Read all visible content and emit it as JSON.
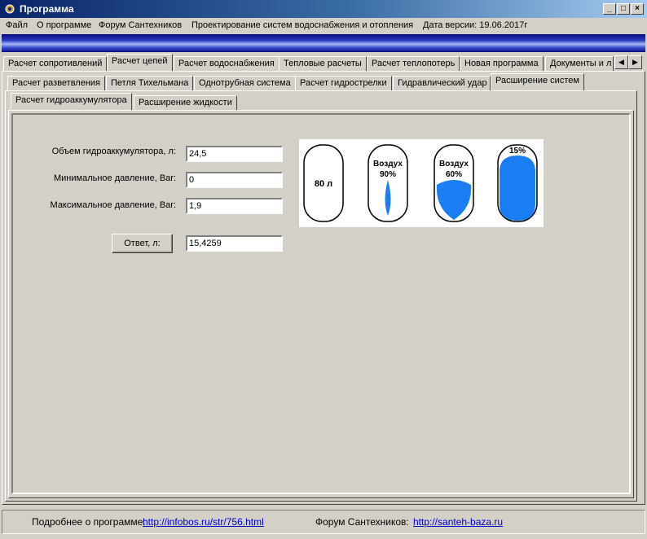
{
  "window": {
    "title": "Программа"
  },
  "menu": [
    "Файл",
    "О программе",
    "Форум Сантехников",
    "Проектирование систем водоснабжения и отопления",
    "Дата версии: 19.06.2017г"
  ],
  "tabs_level1": [
    "Расчет сопротивлений",
    "Расчет цепей",
    "Расчет водоснабжения",
    "Тепловые расчеты",
    "Расчет теплопотерь",
    "Новая программа",
    "Документы и л"
  ],
  "tabs_level2": [
    "Расчет разветвления",
    "Петля Тихельмана",
    "Однотрубная система",
    "Расчет гидрострелки",
    "Гидравлический удар",
    "Расширение систем"
  ],
  "tabs_level3": [
    "Расчет гидроаккумулятора",
    "Расширение жидкости"
  ],
  "form": {
    "volume_label": "Объем гидроаккумулятора, л:",
    "volume_value": "24,5",
    "min_pressure_label": "Минимальное давление, Bar:",
    "min_pressure_value": "0",
    "max_pressure_label": "Максимальное давление, Bar:",
    "max_pressure_value": "1,9",
    "answer_button": "Ответ, л:",
    "answer_value": "15,4259"
  },
  "diagram": {
    "tank1": "80 л",
    "tank2_line1": "Воздух",
    "tank2_line2": "90%",
    "tank3_line1": "Воздух",
    "tank3_line2": "60%",
    "tank4": "15%",
    "fill_color": "#1a7ef2"
  },
  "status": {
    "about_label": "Подробнее о программе:",
    "about_link": "http://infobos.ru/str/756.html",
    "forum_label": "Форум Сантехников:",
    "forum_link": "http://santeh-baza.ru"
  }
}
